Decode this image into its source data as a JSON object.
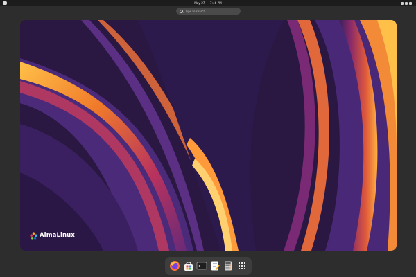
{
  "topbar": {
    "date": "May 27",
    "time": "7:46 PM"
  },
  "search": {
    "placeholder": "Type to search"
  },
  "wallpaper": {
    "brand": "AlmaLinux",
    "colors": {
      "deep": "#231438",
      "violet": "#4b2a7a",
      "magenta": "#8a2a6a",
      "orange": "#f07a2a",
      "yellow": "#ffc048"
    }
  },
  "dock": {
    "apps": [
      {
        "name": "Firefox",
        "icon": "firefox-icon"
      },
      {
        "name": "Software",
        "icon": "software-icon"
      },
      {
        "name": "Terminal",
        "icon": "terminal-icon"
      },
      {
        "name": "Text Editor",
        "icon": "text-editor-icon"
      },
      {
        "name": "Calculator",
        "icon": "calculator-icon"
      },
      {
        "name": "Show Apps",
        "icon": "app-grid-icon"
      }
    ]
  }
}
